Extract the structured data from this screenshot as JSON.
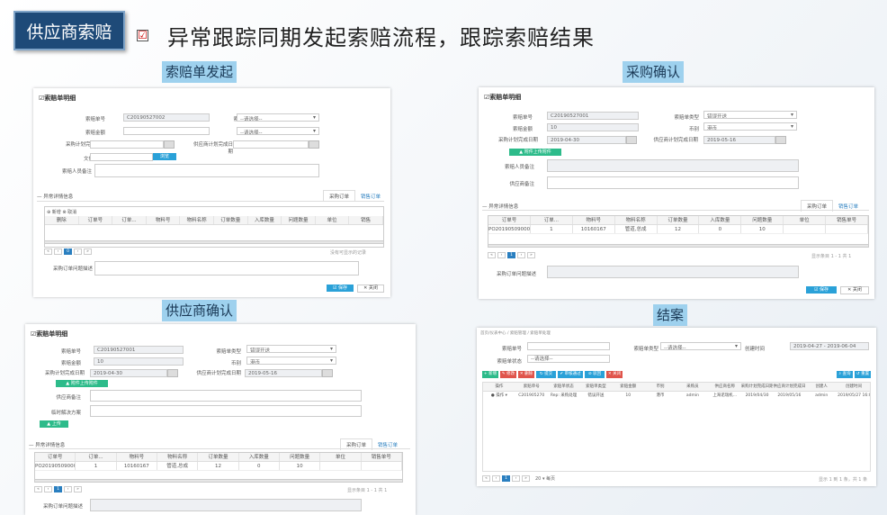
{
  "header": {
    "tag": "供应商索赔",
    "headline": "异常跟踪同期发起索赔流程，跟踪索赔结果"
  },
  "labels": {
    "initiate": "索赔单发起",
    "purchase": "采购确认",
    "supplier": "供应商确认",
    "close": "结案"
  },
  "colors": {
    "title_bg": "#1e4a78",
    "label_bg": "#9ed1ee",
    "primary": "#2aa1d8",
    "success": "#2dbb8a"
  },
  "form": {
    "title": "☑索赔单明细",
    "no_label": "索赔单号",
    "no_value": "C20190527002",
    "no_value2": "C20190527001",
    "type_label": "索赔单类型",
    "type_placeholder": "--请选择--",
    "type_value": "错误开送",
    "amount_label": "索赔金额",
    "amount_value": "10",
    "currency_label": "币别",
    "currency_placeholder": "--请选择--",
    "currency_value": "港币",
    "plan_date_label": "采购计划完成日期",
    "plan_date_value": "2019-04-30",
    "sup_date_label": "供应商计划完成日期",
    "sup_date_value": "2019-05-16",
    "file_label": "文件选择",
    "browse_btn": "浏览",
    "download_btn": "▲ 附件上传附件",
    "initiator_note": "索赔人员备注",
    "supplier_note": "供应商备注",
    "solution": "临时解决方案",
    "upload_btn": "▲ 上传",
    "sub_title": "— 异常详情信息",
    "tab_order": "采购订单",
    "tab_sales": "销售订单",
    "add_btn": "⊕ 新增",
    "del_btn": "⊗ 取消",
    "cols": [
      "删除",
      "订单号",
      "订单...",
      "物料号",
      "物料名称",
      "订单数量",
      "入库数量",
      "问题数量",
      "单位",
      "销售"
    ],
    "cols2": [
      "订单号",
      "订单...",
      "物料号",
      "物料名称",
      "订单数量",
      "入库数量",
      "问题数量",
      "单位",
      "销售单号"
    ],
    "row": [
      "PO201905090004",
      "1",
      "10160167",
      "管道,总成",
      "12",
      "0",
      "10",
      "",
      ""
    ],
    "no_data": "没有可显示的记录",
    "page_info": "显示条目 1 - 1 共 1",
    "page_cur": "1",
    "page_zero": "0",
    "problem_desc": "采购订单问题描述",
    "save_btn": "☑ 保存",
    "close_btn": "✕ 关闭"
  },
  "list": {
    "breadcrumb": "首页/仪表中心 / 索赔管理 / 索赔单处理",
    "f_no": "索赔单号",
    "f_type": "索赔单类型",
    "f_type_val": "--请选择--",
    "f_date": "创建时间",
    "f_date_val": "2019-04-27 - 2019-06-04",
    "f_status": "索赔单状态",
    "f_status_val": "--请选择--",
    "buttons": [
      "+ 新增",
      "✎ 修改",
      "✕ 删除",
      "↻ 提交",
      "✔ 审核通过",
      "⊘ 驳回",
      "✕ 关闭"
    ],
    "btn_colors": [
      "#2dbb8a",
      "#e0544b",
      "#e0544b",
      "#2aa1d8",
      "#2aa1d8",
      "#2aa1d8",
      "#e0544b"
    ],
    "btn_search": "⌕ 查询",
    "btn_reset": "↺ 重置",
    "cols": [
      "操作",
      "索赔单号",
      "索赔单状态",
      "索赔单类型",
      "索赔金额",
      "币别",
      "采购员",
      "供应商名称",
      "采购计划完成日期",
      "供应商计划完成日期",
      "创建人",
      "创建时间"
    ],
    "row": [
      "● 操作 ▾",
      "C201905270",
      "Rep: 采购处理",
      "错误开送",
      "10",
      "港币",
      "admin",
      "上海诺瑞机...",
      "2019/04/30",
      "2019/05/16",
      "admin",
      "2019/05/27 16:07:14"
    ],
    "page_info": "显示 1 到 1 条，共 1 条",
    "page_size": "20 ▾ 每页"
  }
}
